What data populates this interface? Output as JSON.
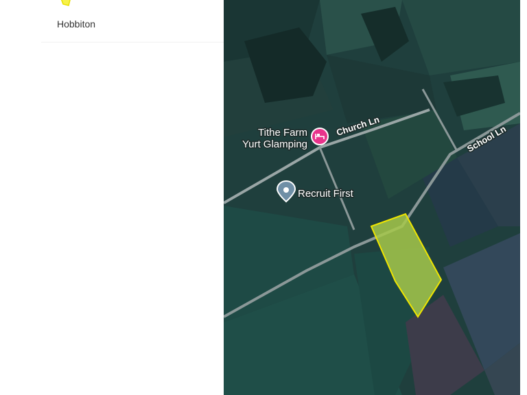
{
  "sidebar": {
    "place_name": "Hobbiton",
    "place_icon": "plot-outline-icon"
  },
  "map": {
    "type": "satellite",
    "roads": [
      {
        "name": "Church Ln"
      },
      {
        "name": "School Ln"
      }
    ],
    "pois": [
      {
        "name_line1": "Tithe Farm",
        "name_line2": "Yurt Glamping",
        "icon": "bed-icon",
        "color": "#e8338b"
      },
      {
        "name": "Recruit First",
        "icon": "location-pin-icon",
        "color": "#6f8fa6"
      }
    ],
    "highlight": {
      "label": "selected-plot",
      "color": "#f0e600",
      "fill": "#a6c84a"
    }
  }
}
